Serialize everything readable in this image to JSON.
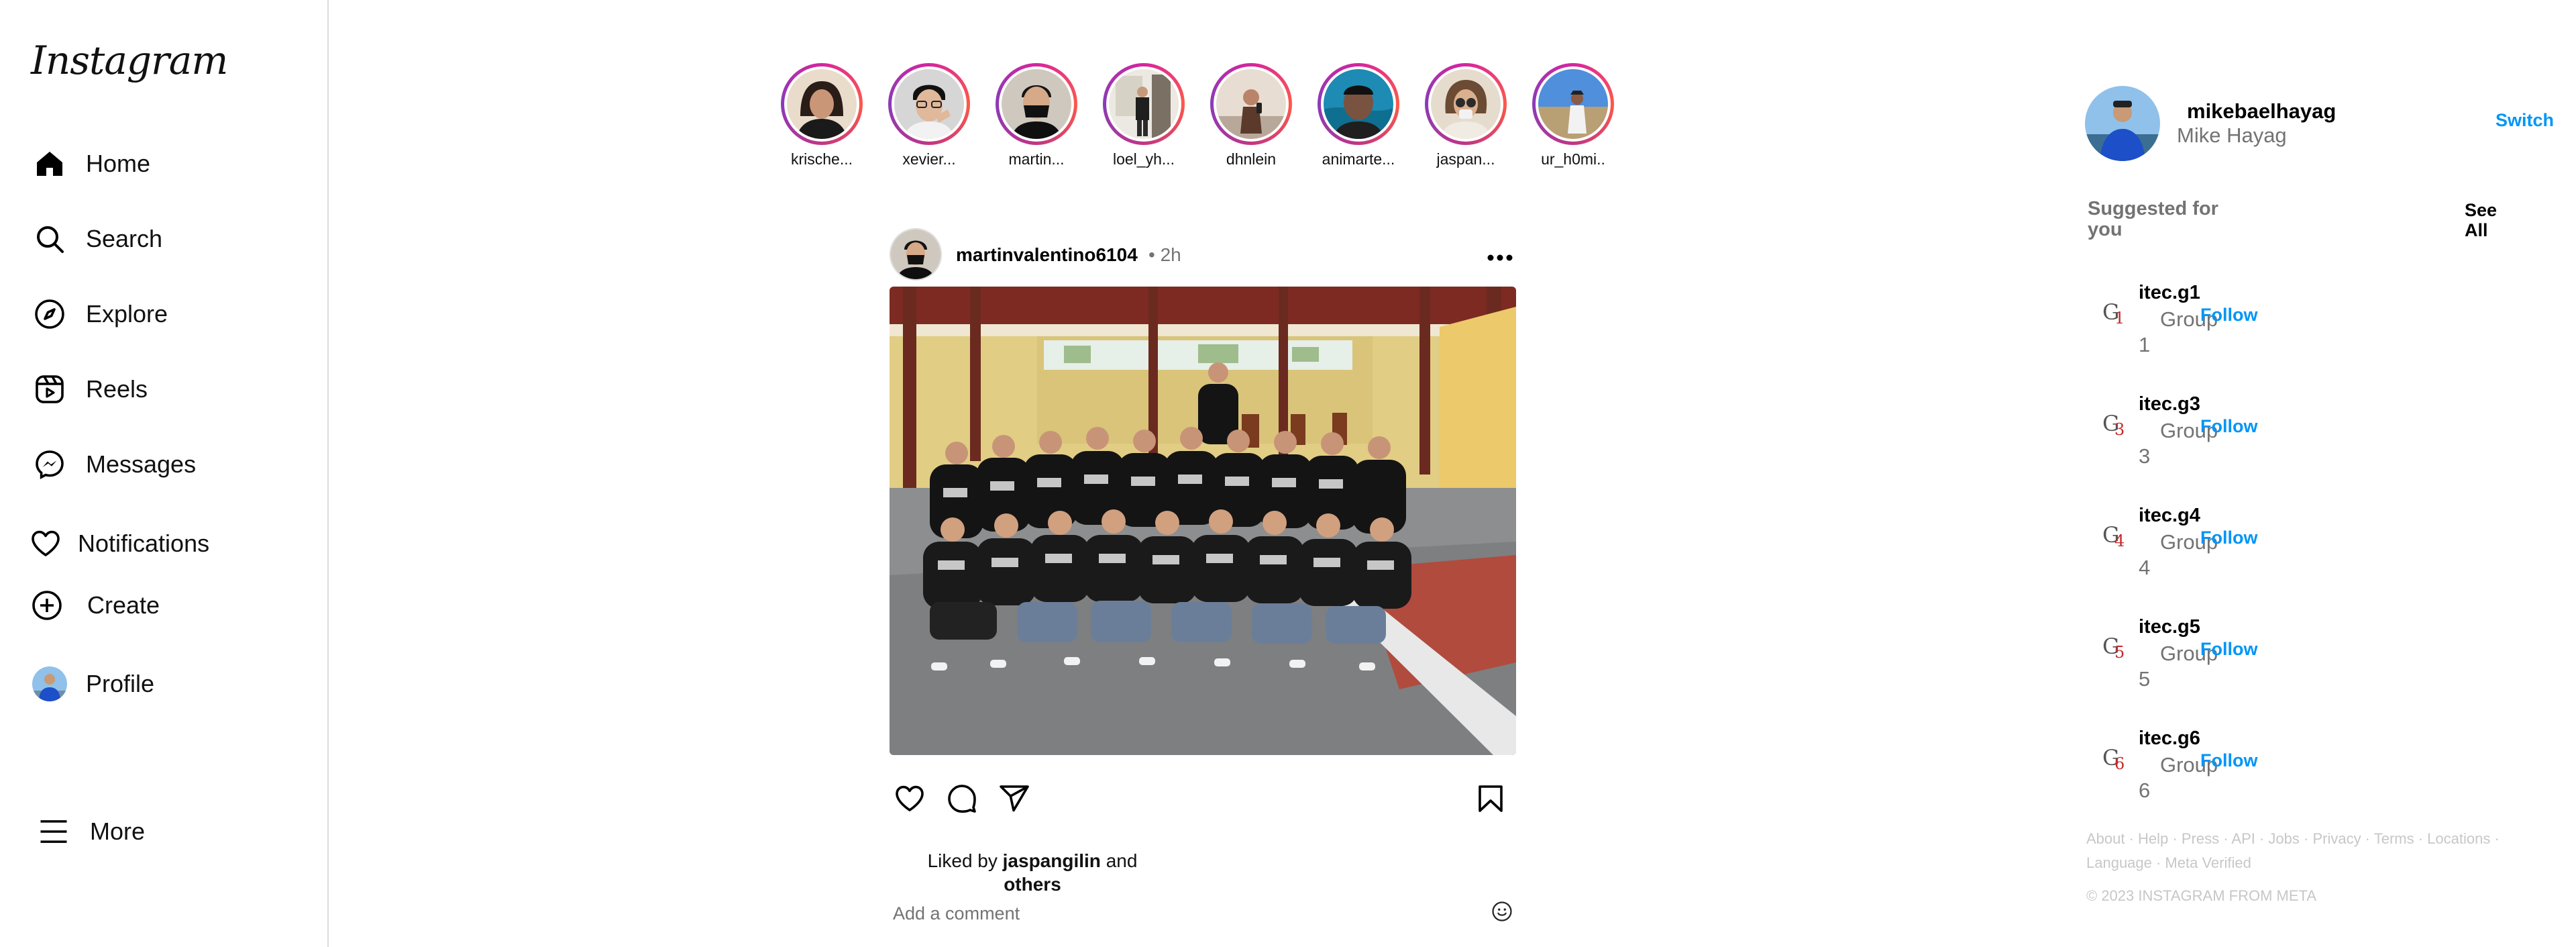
{
  "app": {
    "logo_text": "Instagram"
  },
  "sidebar": {
    "items": [
      {
        "label": "Home",
        "icon": "home-icon"
      },
      {
        "label": "Search",
        "icon": "search-icon"
      },
      {
        "label": "Explore",
        "icon": "compass-icon"
      },
      {
        "label": "Reels",
        "icon": "reels-icon"
      },
      {
        "label": "Messages",
        "icon": "messenger-icon"
      },
      {
        "label": "Notifications",
        "icon": "heart-icon"
      },
      {
        "label": "Create",
        "icon": "plus-circle-icon"
      },
      {
        "label": "Profile",
        "icon": "profile-avatar"
      }
    ],
    "more_label": "More"
  },
  "stories": [
    {
      "name": "krische..."
    },
    {
      "name": "xevier..."
    },
    {
      "name": "martin..."
    },
    {
      "name": "loel_yh..."
    },
    {
      "name": "dhnlein"
    },
    {
      "name": "animarte..."
    },
    {
      "name": "jaspan..."
    },
    {
      "name": "ur_h0mi.."
    }
  ],
  "post": {
    "username": "martinvalentino6104",
    "time": "• 2h",
    "more_icon": "more-horizontal-icon",
    "liked_prefix": "Liked by",
    "liked_user": "jaspangilin",
    "liked_and": "and",
    "liked_others": "others",
    "comment_placeholder": "Add a comment",
    "action_icons": [
      "heart-icon",
      "comment-icon",
      "share-icon",
      "bookmark-icon"
    ],
    "emoji_icon": "emoji-icon"
  },
  "right": {
    "me": {
      "username": "mikebaelhayag",
      "full_name": "Mike Hayag",
      "switch_label": "Switch"
    },
    "suggested_title": "Suggested for you",
    "see_all": "See All",
    "suggestions": [
      {
        "username": "itec.g1",
        "group": "Group",
        "number": "1",
        "follow": "Follow"
      },
      {
        "username": "itec.g3",
        "group": "Group",
        "number": "3",
        "follow": "Follow"
      },
      {
        "username": "itec.g4",
        "group": "Group",
        "number": "4",
        "follow": "Follow"
      },
      {
        "username": "itec.g5",
        "group": "Group",
        "number": "5",
        "follow": "Follow"
      },
      {
        "username": "itec.g6",
        "group": "Group",
        "number": "6",
        "follow": "Follow"
      }
    ],
    "footer_links": "About · Help · Press · API · Jobs · Privacy · Terms · Locations · Language · Meta Verified",
    "copyright": "© 2023 INSTAGRAM FROM META"
  },
  "colors": {
    "accent": "#0095f6",
    "muted": "#737373",
    "border": "#dbdbdb",
    "logo_red": "#c62828"
  }
}
